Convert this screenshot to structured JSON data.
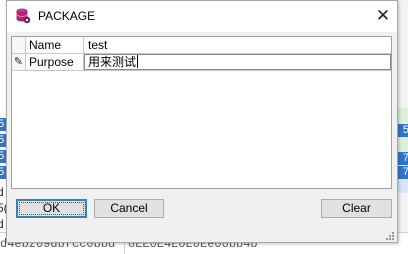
{
  "dialog": {
    "title": "PACKAGE",
    "icon": "package-database-icon",
    "close_label": "✕"
  },
  "grid": {
    "rows": [
      {
        "marker": "",
        "name": "Name",
        "value": "test",
        "editing": false
      },
      {
        "marker": "✎",
        "name": "Purpose",
        "value": "用来测试",
        "editing": true
      }
    ]
  },
  "buttons": {
    "ok": "OK",
    "cancel": "Cancel",
    "clear": "Clear"
  },
  "background": {
    "left_selected": [
      "5",
      "5",
      "5",
      "5"
    ],
    "left_text": [
      "d",
      "5(",
      "d",
      "5"
    ],
    "right_selected": [
      "5",
      "7",
      "7",
      ""
    ],
    "bottom_row": [
      "d4ebz09dbfcc0bbd",
      "0EE0E4E0E0Ee00bb4b"
    ]
  },
  "colors": {
    "accent": "#3174c8",
    "icon": "#b8237a",
    "dialog_bg": "#f0f0f0"
  }
}
